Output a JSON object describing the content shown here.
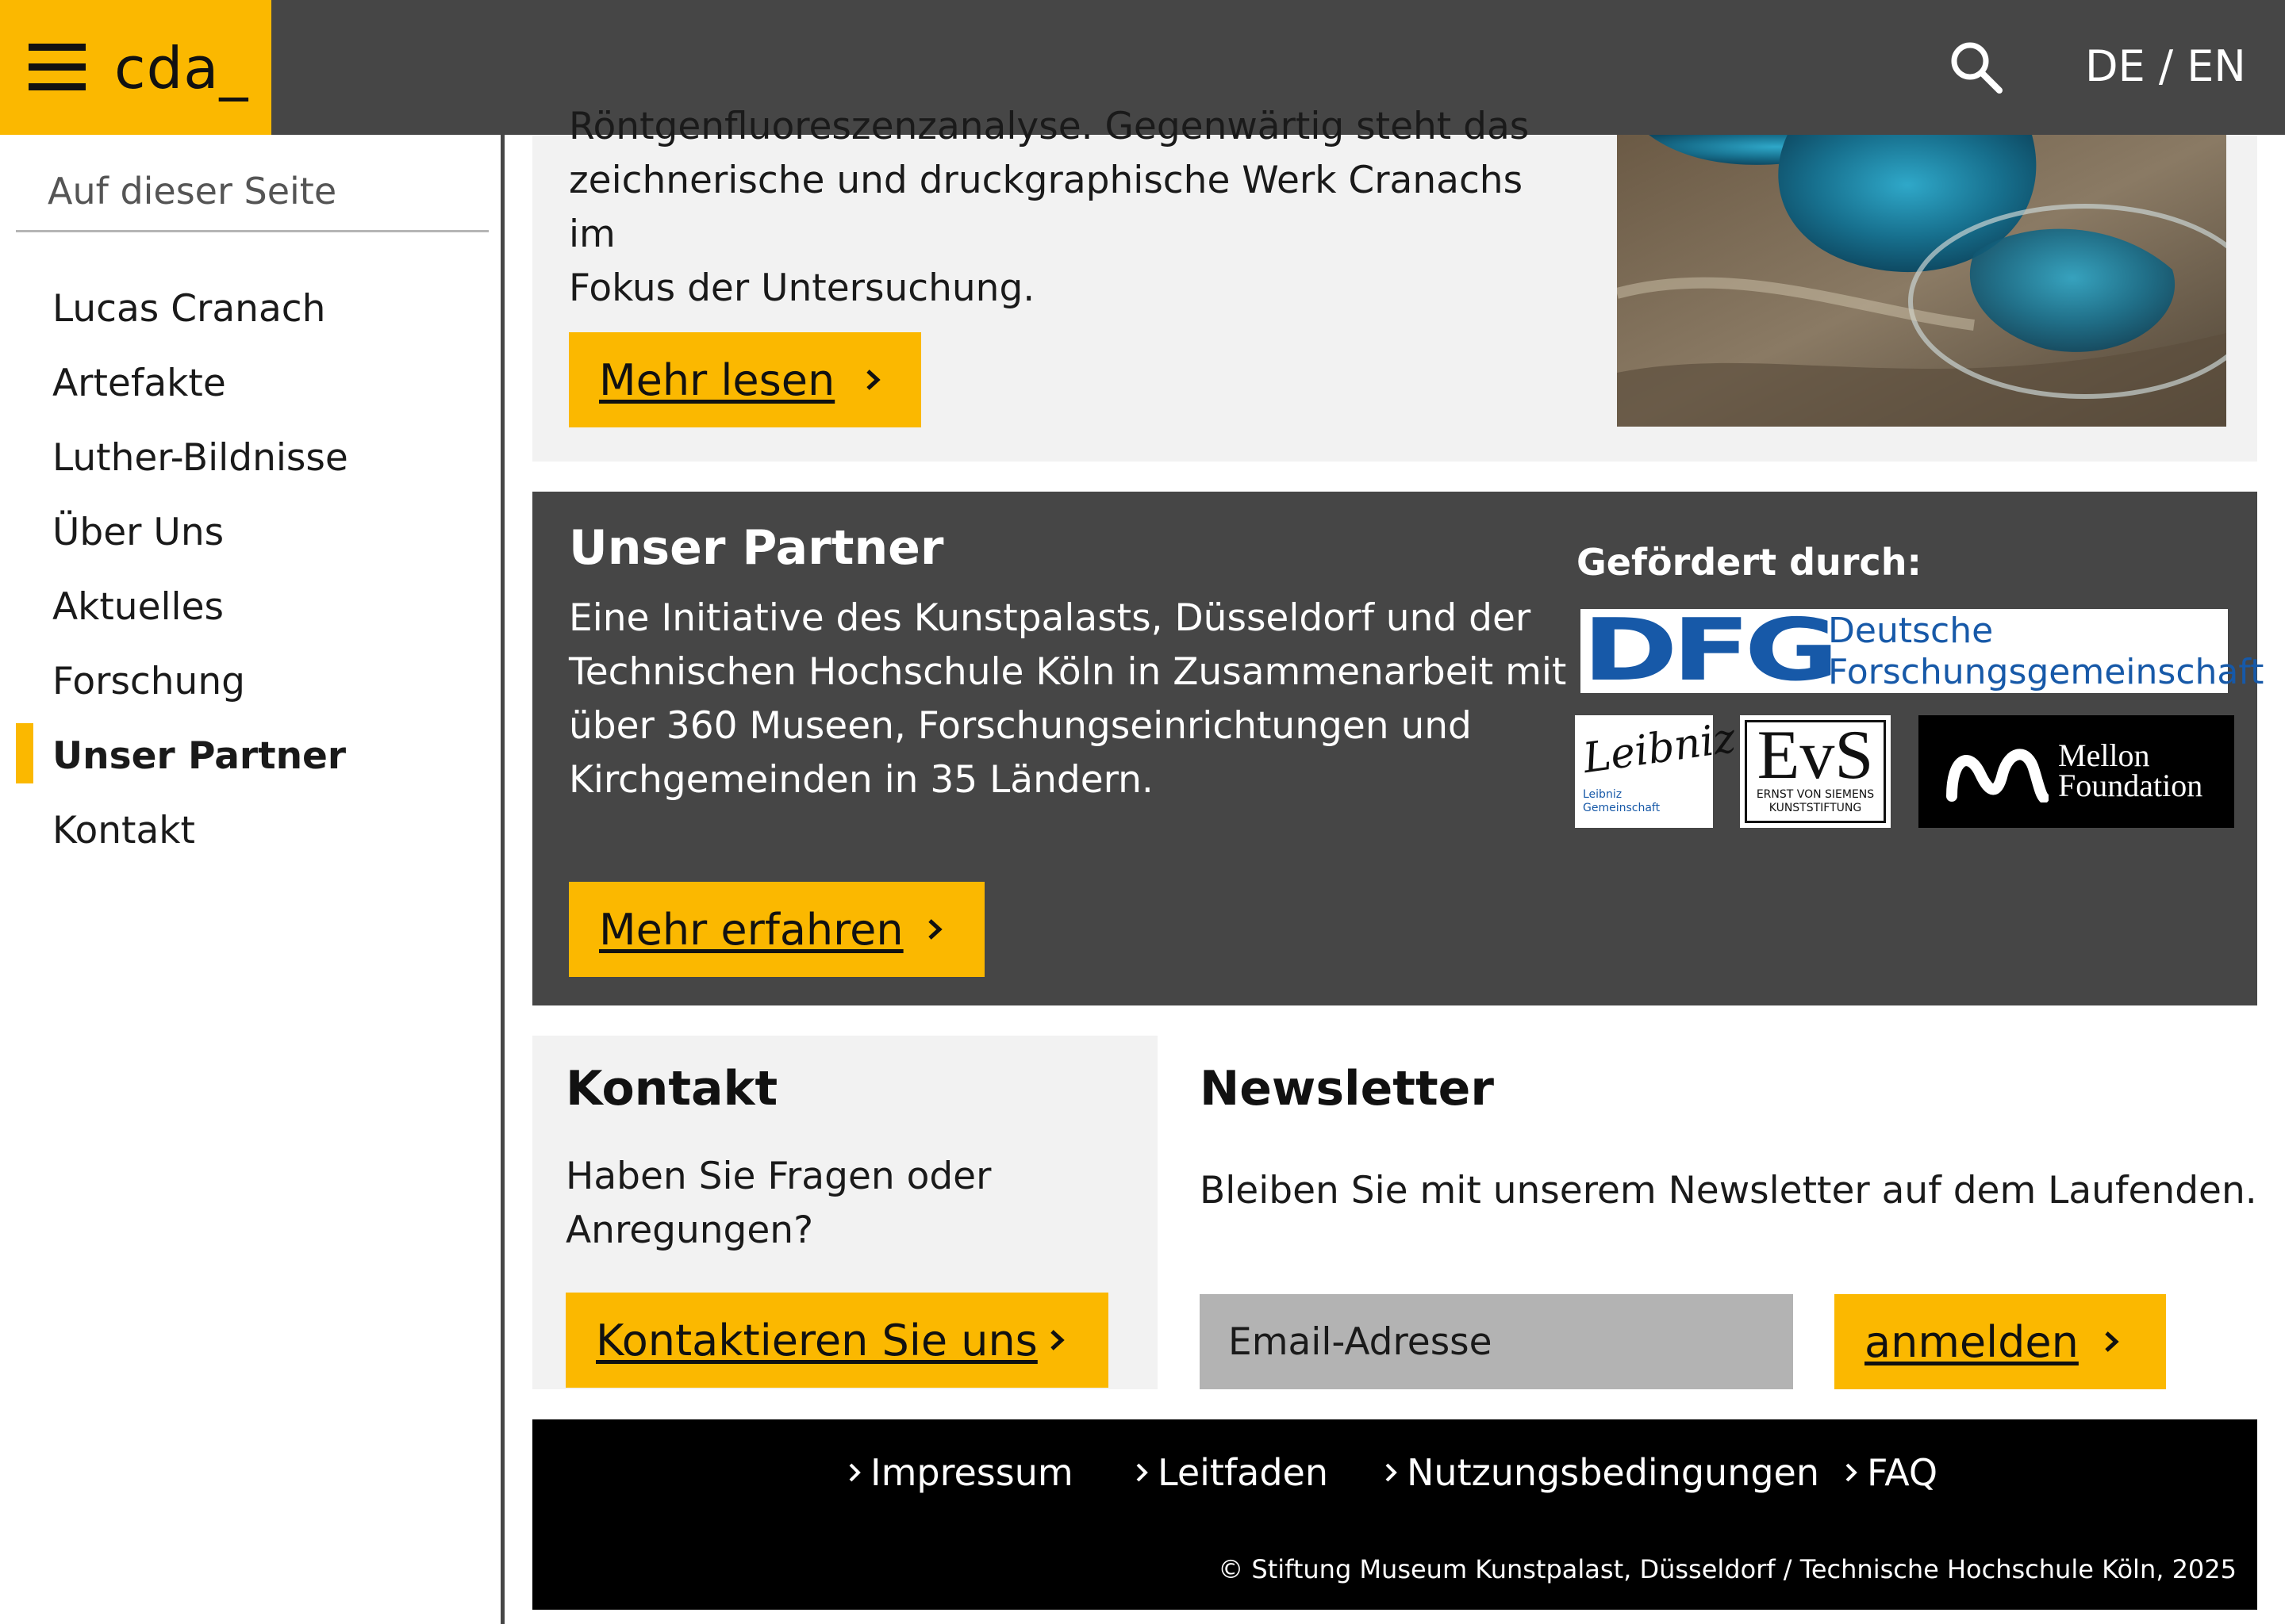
{
  "header": {
    "logo_text": "cda_",
    "lang_de": "DE",
    "lang_sep": "/",
    "lang_en": "EN"
  },
  "sidebar": {
    "title": "Auf dieser Seite",
    "items": [
      {
        "label": "Lucas Cranach"
      },
      {
        "label": "Artefakte"
      },
      {
        "label": "Luther-Bildnisse"
      },
      {
        "label": "Über Uns"
      },
      {
        "label": "Aktuelles"
      },
      {
        "label": "Forschung"
      },
      {
        "label": "Unser Partner"
      },
      {
        "label": "Kontakt"
      }
    ],
    "active_item": "Unser Partner"
  },
  "research": {
    "partial_line": "Röntgenfluoreszenzanalyse. Gegenwärtig steht das",
    "line1": "zeichnerische und druckgraphische Werk Cranachs im",
    "line2": "Fokus der Untersuchung.",
    "button_label": "Mehr lesen"
  },
  "partner": {
    "title": "Unser Partner",
    "line1": "Eine Initiative des Kunstpalasts, Düsseldorf und der",
    "line2": "Technischen Hochschule Köln in Zusammenarbeit mit",
    "line3": "über 360 Museen, Forschungseinrichtungen und",
    "line4": "Kirchgemeinden in 35 Ländern.",
    "button_label": "Mehr erfahren",
    "funded_by": "Gefördert durch:",
    "logos": {
      "dfg_mark": "DFG",
      "dfg_line1": "Deutsche",
      "dfg_line2": "Forschungsgemeinschaft",
      "leibniz_signature": "Leibniz",
      "leibniz_line1": "Leibniz",
      "leibniz_line2": "Gemeinschaft",
      "evs_mark": "EvS",
      "evs_line1": "ERNST VON SIEMENS",
      "evs_line2": "KUNSTSTIFTUNG",
      "mellon_line1": "Mellon",
      "mellon_line2": "Foundation"
    }
  },
  "contact": {
    "title": "Kontakt",
    "line1": "Haben Sie Fragen oder",
    "line2": "Anregungen?",
    "button_label": "Kontaktieren Sie uns"
  },
  "newsletter": {
    "title": "Newsletter",
    "text": "Bleiben Sie mit unserem Newsletter auf dem Laufenden.",
    "email_placeholder": "Email-Adresse",
    "email_value": "",
    "button_label": "anmelden"
  },
  "footer": {
    "links": [
      {
        "label": "Impressum"
      },
      {
        "label": "Leitfaden"
      },
      {
        "label": "Nutzungsbedingungen"
      },
      {
        "label": "FAQ"
      }
    ],
    "copyright": "© Stiftung Museum Kunstpalast, Düsseldorf / Technische Hochschule Köln, 2025"
  },
  "colors": {
    "accent": "#fbb800",
    "header_bg": "#464646",
    "card_light": "#f2f2f2",
    "footer_bg": "#000000",
    "dfg_blue": "#1759a8"
  }
}
